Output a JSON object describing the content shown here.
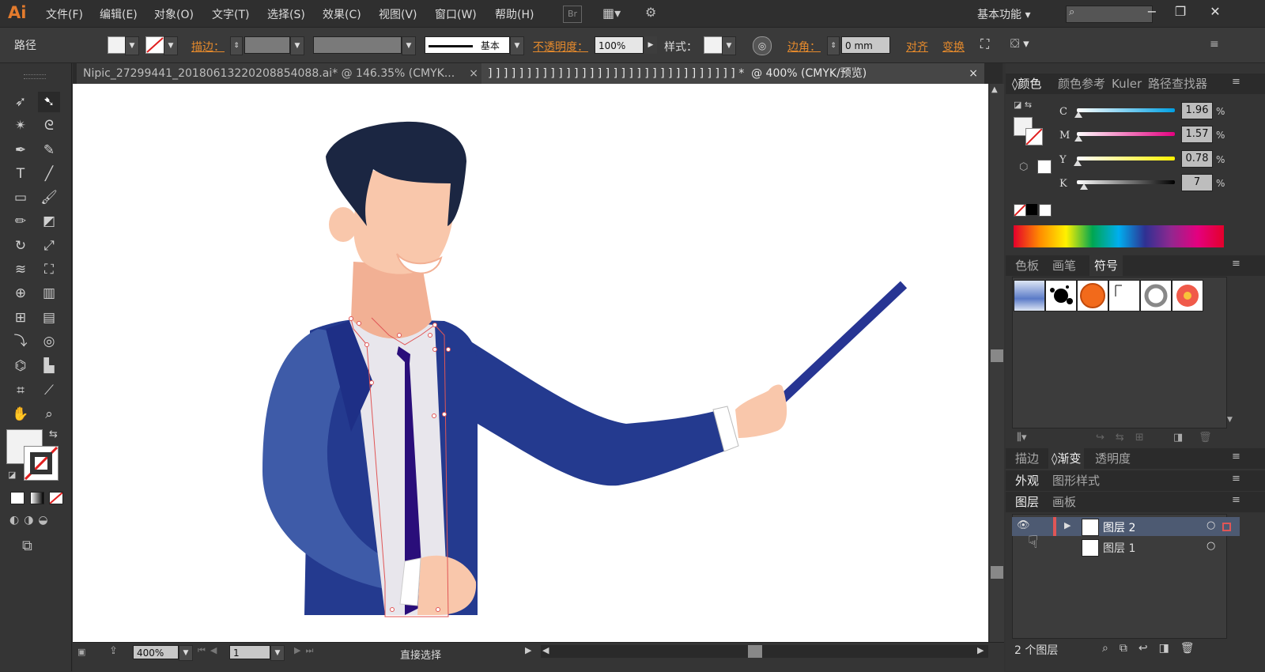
{
  "app": {
    "logo": "Ai"
  },
  "menu": [
    "文件(F)",
    "编辑(E)",
    "对象(O)",
    "文字(T)",
    "选择(S)",
    "效果(C)",
    "视图(V)",
    "窗口(W)",
    "帮助(H)"
  ],
  "bridge_label": "Br",
  "workspace": "基本功能",
  "control": {
    "object_type": "路径",
    "stroke_label": "描边：",
    "stroke_style": "基本",
    "opacity_label": "不透明度：",
    "opacity_value": "100%",
    "style_label": "样式：",
    "corner_label": "边角：",
    "corner_value": "0 mm",
    "align_label": "对齐",
    "transform_label": "变换"
  },
  "tabs": {
    "tab1": "Nipic_27299441_20180613220208854088.ai* @ 146.35% (CMYK...",
    "tab2_prefix": "] ] ] ] ] ] ] ] ] ] ] ] ] ] ] ] ] ] ] ] ] ] ] ] ] ] ] ] ] ] ] ] *",
    "tab2_suffix": "@  400%  (CMYK/预览)"
  },
  "status": {
    "zoom": "400%",
    "page": "1",
    "tool": "直接选择"
  },
  "color_panel": {
    "tabs": [
      "颜色",
      "颜色参考",
      "Kuler",
      "路径查找器"
    ],
    "channels": [
      {
        "label": "C",
        "value": "1.96",
        "fraction": 0.02
      },
      {
        "label": "M",
        "value": "1.57",
        "fraction": 0.016
      },
      {
        "label": "Y",
        "value": "0.78",
        "fraction": 0.008
      },
      {
        "label": "K",
        "value": "7",
        "fraction": 0.07
      }
    ],
    "pct": "%"
  },
  "swatch_panel": {
    "tabs": [
      "色板",
      "画笔",
      "符号"
    ]
  },
  "stroke_panel": {
    "tabs": [
      "描边",
      "渐变",
      "透明度"
    ]
  },
  "appearance_panel": {
    "tabs": [
      "外观",
      "图形样式"
    ]
  },
  "layers_panel": {
    "tabs": [
      "图层",
      "画板"
    ],
    "layers": [
      "图层 2",
      "图层 1"
    ],
    "count": "2 个图层"
  },
  "colors": {
    "accent": "#e58a2c",
    "suit": "#243a8f",
    "suit_light": "#3e5ba8",
    "hair": "#1b2642",
    "skin": "#f9c7ab",
    "tie": "#2a0e7a",
    "selection": "#e05656",
    "layer_highlight": "#4d5a72"
  }
}
